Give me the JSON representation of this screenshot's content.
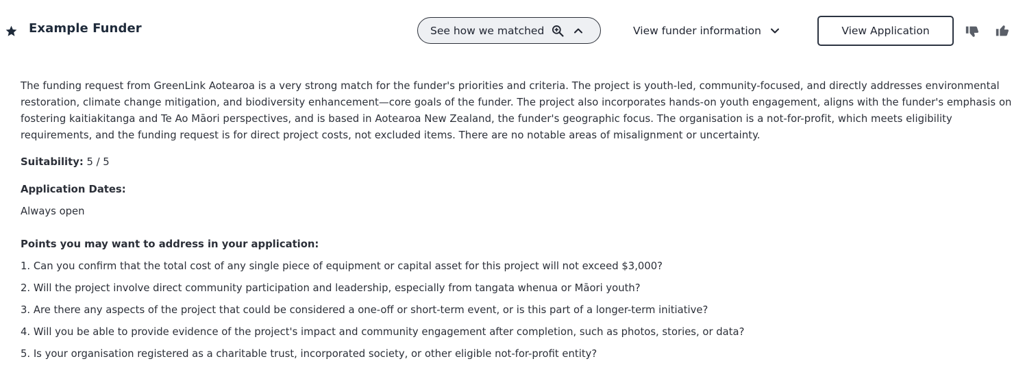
{
  "header": {
    "funder_name": "Example Funder",
    "match_button_label": "See how we matched",
    "funder_info_label": "View funder information",
    "view_application_label": "View Application",
    "icons": {
      "favorite": "star-icon",
      "match_search": "zoom-in-icon",
      "match_toggle": "chevron-up-icon",
      "funder_info_toggle": "chevron-down-icon",
      "dislike": "thumbs-down-icon",
      "like": "thumbs-up-icon"
    }
  },
  "colors": {
    "text": "#2b2f38",
    "heading": "#1e2a3a",
    "match_button_bg": "#eef0f3",
    "button_border": "#2b3340"
  },
  "summary": "The funding request from GreenLink Aotearoa is a very strong match for the funder's priorities and criteria. The project is youth-led, community-focused, and directly addresses environmental restoration, climate change mitigation, and biodiversity enhancement—core goals of the funder. The project also incorporates hands-on youth engagement, aligns with the funder's emphasis on fostering kaitiakitanga and Te Ao Māori perspectives, and is based in Aotearoa New Zealand, the funder's geographic focus. The organisation is a not-for-profit, which meets eligibility requirements, and the funding request is for direct project costs, not excluded items. There are no notable areas of misalignment or uncertainty.",
  "suitability": {
    "label": "Suitability:",
    "value": "5 / 5"
  },
  "application_dates": {
    "label": "Application Dates:",
    "value": "Always open"
  },
  "points": {
    "heading": "Points you may want to address in your application:",
    "items": [
      "1. Can you confirm that the total cost of any single piece of equipment or capital asset for this project will not exceed $3,000?",
      "2. Will the project involve direct community participation and leadership, especially from tangata whenua or Māori youth?",
      "3. Are there any aspects of the project that could be considered a one-off or short-term event, or is this part of a longer-term initiative?",
      "4. Will you be able to provide evidence of the project's impact and community engagement after completion, such as photos, stories, or data?",
      "5. Is your organisation registered as a charitable trust, incorporated society, or other eligible not-for-profit entity?"
    ]
  }
}
